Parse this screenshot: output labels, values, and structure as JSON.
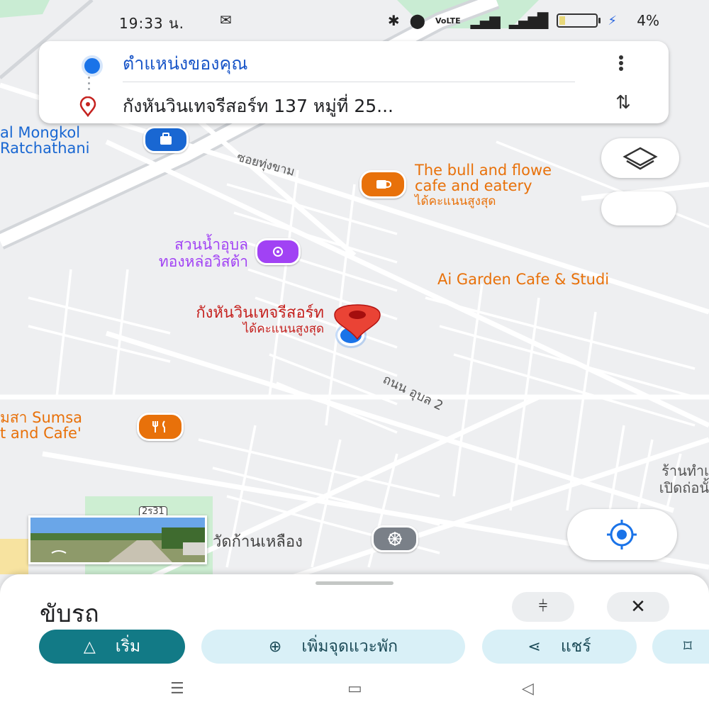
{
  "status_bar": {
    "time": "19:33 น.",
    "mail_icon": "gmail-icon",
    "network_label": "VoLTE",
    "battery_percent": "4%",
    "battery_level": 0.04
  },
  "route": {
    "origin": "ตำแหน่งของคุณ",
    "destination": "กังหันวินเทจรีสอร์ท 137 หมู่ที่ 25..."
  },
  "map": {
    "roads": {
      "soi": "ซอยทุ่งขาม",
      "road": "ถนน อุบล 2"
    },
    "places": {
      "hospital": [
        "al Mongkol",
        "Ratchathani"
      ],
      "cafe": [
        "The bull and flowe",
        "cafe and eatery"
      ],
      "cafe_note": "ได้คะแนนสูงสุด",
      "park": [
        "สวนน้ำอุบล",
        "ทองหล่อวิสต้า"
      ],
      "garden": "Ai Garden Cafe & Studi",
      "resort": "กังหันวินเทจรีสอร์ท",
      "resort_note": "ได้คะแนนสูงสุด",
      "restaurant": [
        "มสา Sumsa",
        "t and Cafe'"
      ],
      "temple": "วัดก้านเหลือง",
      "shop": [
        "ร้านทำเ",
        "เปิดถ่อนั้"
      ],
      "road_badge": "2ร31"
    },
    "colors": {
      "cafe_orange": "#e8710a",
      "place_purple": "#a142f4",
      "pin_red": "#ea4335",
      "blue_dot": "#1a73e8",
      "hospital_blue": "#1967d2"
    }
  },
  "sheet": {
    "title": "ขับรถ",
    "buttons": {
      "start": "เริ่ม",
      "add_stop": "เพิ่มจุดแวะพัก",
      "share": "แชร์"
    }
  }
}
